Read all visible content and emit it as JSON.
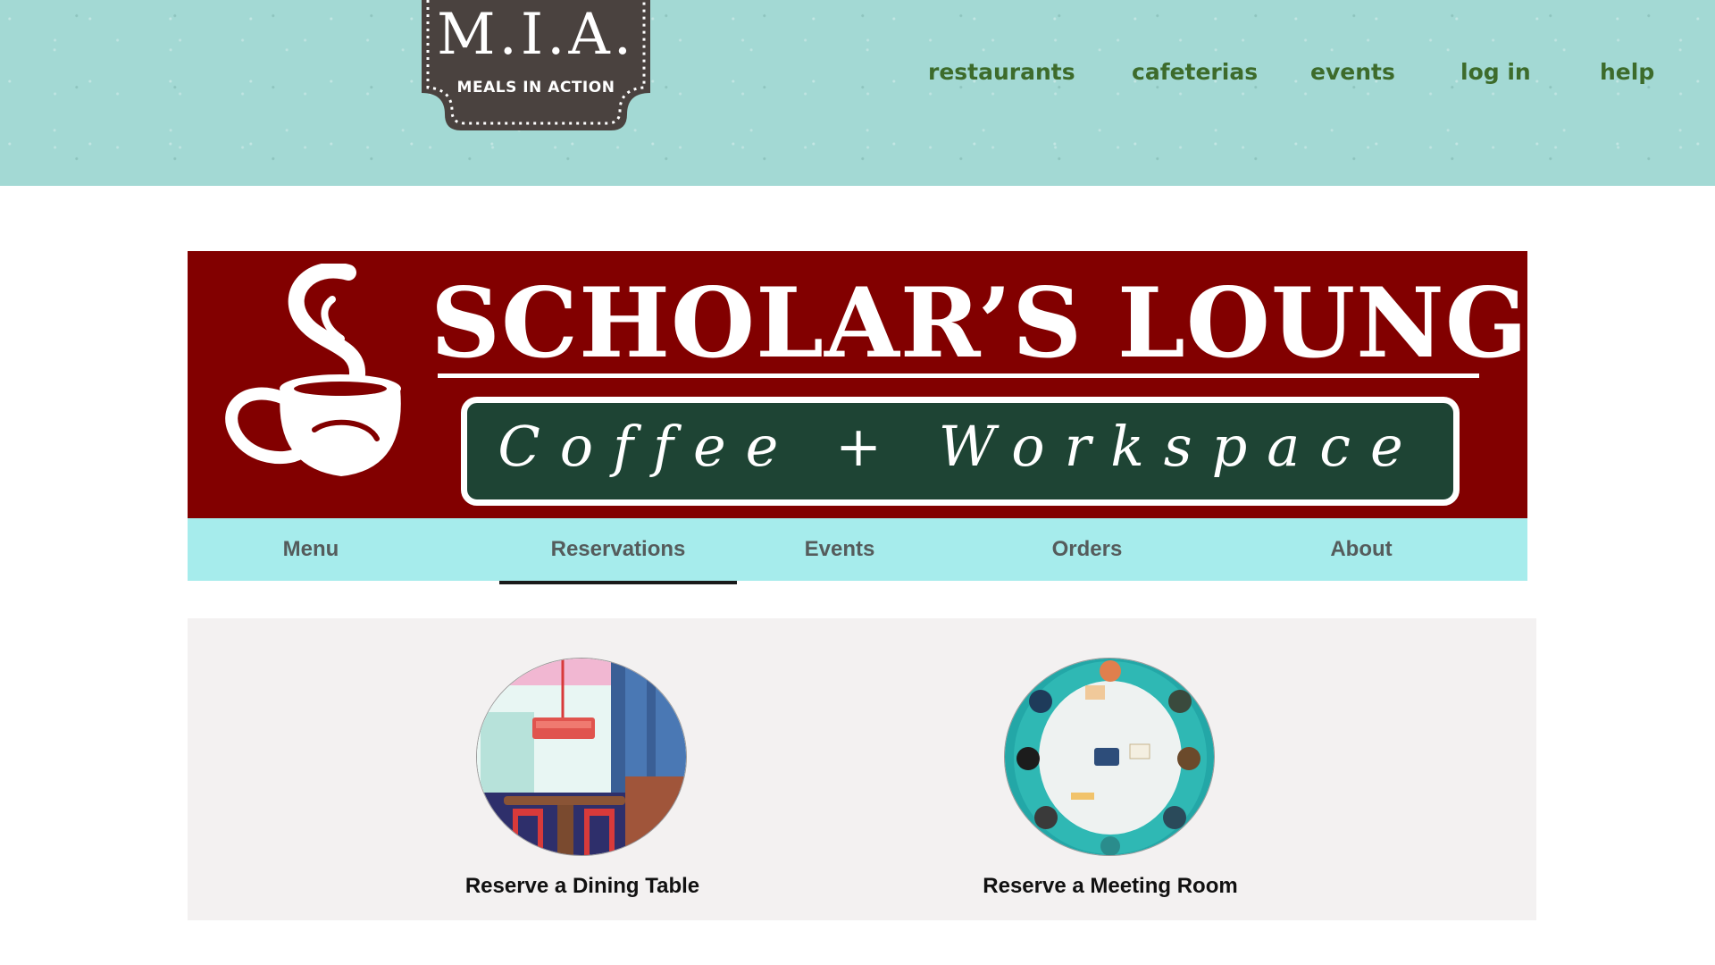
{
  "header": {
    "logo": {
      "title": "M.I.A.",
      "subtitle": "MEALS IN ACTION"
    },
    "nav": [
      {
        "label": "restaurants"
      },
      {
        "label": "cafeterias"
      },
      {
        "label": "events"
      },
      {
        "label": "log in"
      },
      {
        "label": "help"
      }
    ]
  },
  "banner": {
    "title": "SCHOLAR’S LOUNGE",
    "subtitle": "Coffee + Workspace",
    "icon": "coffee-cup-icon"
  },
  "tabs": [
    {
      "label": "Menu",
      "active": false
    },
    {
      "label": "Reservations",
      "active": true
    },
    {
      "label": "Events",
      "active": false
    },
    {
      "label": "Orders",
      "active": false
    },
    {
      "label": "About",
      "active": false
    }
  ],
  "reservations": [
    {
      "label": "Reserve a Dining Table",
      "image": "dining-table-illustration"
    },
    {
      "label": "Reserve a Meeting Room",
      "image": "meeting-room-illustration"
    }
  ],
  "colors": {
    "header_bg": "#a3d9d4",
    "nav_text": "#3d6b2b",
    "banner_bg": "#820000",
    "banner_pill": "#1e4434",
    "tab_bar_bg": "#a6ecec",
    "panel_bg": "#f3f1f1"
  }
}
